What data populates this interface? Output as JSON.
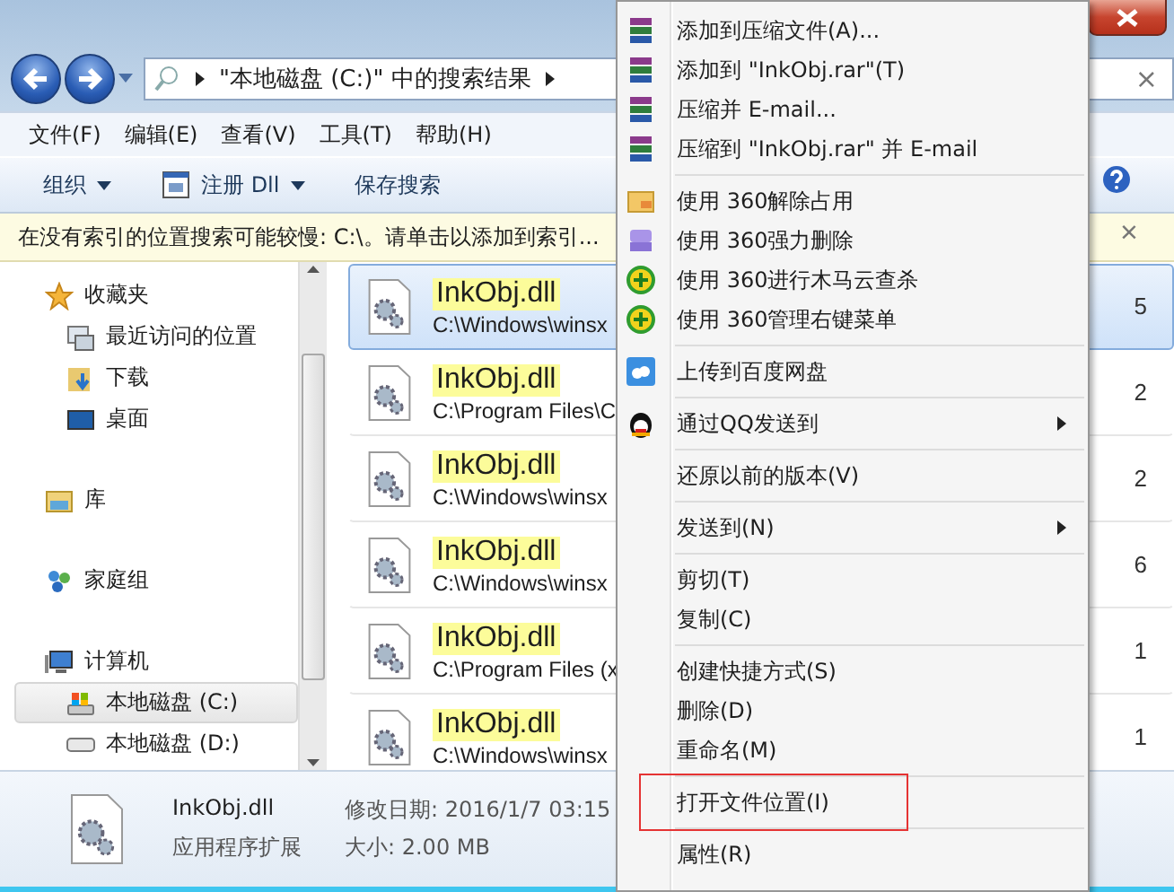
{
  "address": {
    "path": "\"本地磁盘 (C:)\" 中的搜索结果",
    "search_clear": "×"
  },
  "menu_bar": [
    "文件(F)",
    "编辑(E)",
    "查看(V)",
    "工具(T)",
    "帮助(H)"
  ],
  "toolbar": [
    {
      "label": "组织",
      "dropdown": true,
      "icon": false
    },
    {
      "label": "注册 Dll",
      "dropdown": true,
      "icon": true
    },
    {
      "label": "保存搜索",
      "dropdown": false,
      "icon": false
    }
  ],
  "info_bar": {
    "text": "在没有索引的位置搜索可能较慢: C:\\。请单击以添加到索引...",
    "close": "×"
  },
  "navigation": [
    {
      "label": "收藏夹",
      "selected": false,
      "children": [
        {
          "label": "最近访问的位置",
          "selected": false
        },
        {
          "label": "下载",
          "selected": false
        },
        {
          "label": "桌面",
          "selected": false
        }
      ]
    },
    {
      "label": "库",
      "selected": false
    },
    {
      "label": "家庭组",
      "selected": false
    },
    {
      "label": "计算机",
      "selected": false,
      "children": [
        {
          "label": "本地磁盘 (C:)",
          "selected": true
        },
        {
          "label": "本地磁盘 (D:)",
          "selected": false
        }
      ]
    }
  ],
  "results": [
    {
      "name": "InkObj.dll",
      "path": "C:\\Windows\\winsx",
      "column_3": "5",
      "selected": true
    },
    {
      "name": "InkObj.dll",
      "path": "C:\\Program Files\\C",
      "column_3": "2",
      "selected": false
    },
    {
      "name": "InkObj.dll",
      "path": "C:\\Windows\\winsx",
      "column_3": "2",
      "selected": false
    },
    {
      "name": "InkObj.dll",
      "path": "C:\\Windows\\winsx",
      "column_3": "6",
      "selected": false
    },
    {
      "name": "InkObj.dll",
      "path": "C:\\Program Files (x",
      "column_3": "1",
      "selected": false
    },
    {
      "name": "InkObj.dll",
      "path": "C:\\Windows\\winsx",
      "column_3": "1",
      "selected": false
    }
  ],
  "details": {
    "name": "InkObj.dll",
    "type": "应用程序扩展",
    "modified": "修改日期: 2016/1/7 03:15",
    "size": "大小: 2.00 MB"
  },
  "context_menu": [
    [
      {
        "label": "添加到压缩文件(A)...",
        "submenu": false,
        "outlined": false
      },
      {
        "label": "添加到 \"InkObj.rar\"(T)",
        "submenu": false,
        "outlined": false
      },
      {
        "label": "压缩并 E-mail...",
        "submenu": false,
        "outlined": false
      },
      {
        "label": "压缩到 \"InkObj.rar\" 并 E-mail",
        "submenu": false,
        "outlined": false
      }
    ],
    [
      {
        "label": "使用 360解除占用",
        "submenu": false,
        "outlined": false
      },
      {
        "label": "使用 360强力删除",
        "submenu": false,
        "outlined": false
      },
      {
        "label": "使用 360进行木马云查杀",
        "submenu": false,
        "outlined": false
      },
      {
        "label": "使用 360管理右键菜单",
        "submenu": false,
        "outlined": false
      }
    ],
    [
      {
        "label": "上传到百度网盘",
        "submenu": false,
        "outlined": false
      }
    ],
    [
      {
        "label": "通过QQ发送到",
        "submenu": true,
        "outlined": false
      }
    ],
    [
      {
        "label": "还原以前的版本(V)",
        "submenu": false,
        "outlined": false
      }
    ],
    [
      {
        "label": "发送到(N)",
        "submenu": true,
        "outlined": false
      }
    ],
    [
      {
        "label": "剪切(T)",
        "submenu": false,
        "outlined": false
      },
      {
        "label": "复制(C)",
        "submenu": false,
        "outlined": false
      }
    ],
    [
      {
        "label": "创建快捷方式(S)",
        "submenu": false,
        "outlined": false
      },
      {
        "label": "删除(D)",
        "submenu": false,
        "outlined": false
      },
      {
        "label": "重命名(M)",
        "submenu": false,
        "outlined": false
      }
    ],
    [
      {
        "label": "打开文件位置(I)",
        "submenu": false,
        "outlined": true
      }
    ],
    [
      {
        "label": "属性(R)",
        "submenu": false,
        "outlined": false
      }
    ]
  ]
}
